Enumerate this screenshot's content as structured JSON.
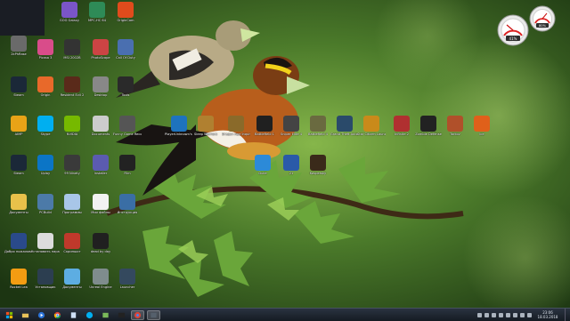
{
  "desktop": {
    "icons": [
      {
        "name": "Yandex",
        "label": "Yandex"
      },
      {
        "name": "GOG Galaxy",
        "label": "GOG Galaxy"
      },
      {
        "name": "MPC-HC 64",
        "label": "MPC-HC 64"
      },
      {
        "name": "Origin",
        "label": "OriginCom"
      },
      {
        "name": "2FILTRE",
        "label": "2kPhRase"
      },
      {
        "name": "Picasa 3",
        "label": "Picasa 3"
      },
      {
        "name": "MSI 2002",
        "label": "MSI 2002B"
      },
      {
        "name": "Photoscape",
        "label": "PhotoScape"
      },
      {
        "name": "Call of Duty",
        "label": "Call Of Duty"
      },
      {
        "name": "Steam",
        "label": "Steam"
      },
      {
        "name": "Origin Games",
        "label": "Origin"
      },
      {
        "name": "Resident Evil",
        "label": "Resident Evil 2"
      },
      {
        "name": "Desktop Screen",
        "label": "Desktop"
      },
      {
        "name": "Tools",
        "label": "Tools"
      },
      {
        "name": "AIMP",
        "label": "AIMP"
      },
      {
        "name": "Skype",
        "label": "Skype"
      },
      {
        "name": "NVIDIA",
        "label": "NVIDIA"
      },
      {
        "name": "Documents",
        "label": "Documents"
      },
      {
        "name": "Funny Tools",
        "label": "Funny Game Recorder"
      },
      {
        "name": "Steam2",
        "label": "Steam"
      },
      {
        "name": "Uplay",
        "label": "Uplay"
      },
      {
        "name": "Ninety Nine",
        "label": "99 Ninety"
      },
      {
        "name": "Installer",
        "label": "Installer"
      },
      {
        "name": "Film",
        "label": "Film"
      },
      {
        "name": "Folder Docs",
        "label": "Документы"
      },
      {
        "name": "PC Build",
        "label": "PCBuild"
      },
      {
        "name": "Programs",
        "label": "Программы"
      },
      {
        "name": "Paper",
        "label": "Мои файлы"
      },
      {
        "name": "Manual",
        "label": "Инструкция"
      },
      {
        "name": "Dobro",
        "label": "Добро пожаловать"
      },
      {
        "name": "Tuner",
        "label": "Установить параметры"
      },
      {
        "name": "Screenshot",
        "label": "Скриншот"
      },
      {
        "name": "Dead",
        "label": "dead by day"
      },
      {
        "name": "Rocket",
        "label": "Rocket Lea"
      },
      {
        "name": "Hardware",
        "label": "Установщик"
      },
      {
        "name": "Docs2",
        "label": "Документы"
      },
      {
        "name": "Unreal",
        "label": "Unreal Engine"
      },
      {
        "name": "Launcher",
        "label": "Launcher"
      },
      {
        "name": "PlayerUnknown",
        "label": "PlayerUnknown's Battlegrounds"
      },
      {
        "name": "Sleep",
        "label": "Sleep Warriors"
      },
      {
        "name": "Dragon Age",
        "label": "Dragon Age Inquisition"
      },
      {
        "name": "Battlefield",
        "label": "Battlefield 1"
      },
      {
        "name": "Sniper Elite",
        "label": "Sniper Elite 4"
      },
      {
        "name": "Battlefield 2",
        "label": "Battlefield 4"
      },
      {
        "name": "GTA",
        "label": "Grand Theft Auto V"
      },
      {
        "name": "Star Citizen",
        "label": "Star Citizen Launcher"
      },
      {
        "name": "Infinite",
        "label": "Infinite 2"
      },
      {
        "name": "Zombie",
        "label": "Zombie Defense"
      },
      {
        "name": "Tarkov",
        "label": "Tarkov"
      },
      {
        "name": "Ice",
        "label": "Ice"
      },
      {
        "name": "Duke",
        "label": "Duke"
      },
      {
        "name": "21",
        "label": "21"
      },
      {
        "name": "Kaspersky",
        "label": "Kaspersky"
      }
    ]
  },
  "gadgets": {
    "cpu_percent": "41%",
    "ram_percent": "80%"
  },
  "taskbar": {
    "clock_time": "23:06",
    "clock_date": "18.03.2018"
  }
}
